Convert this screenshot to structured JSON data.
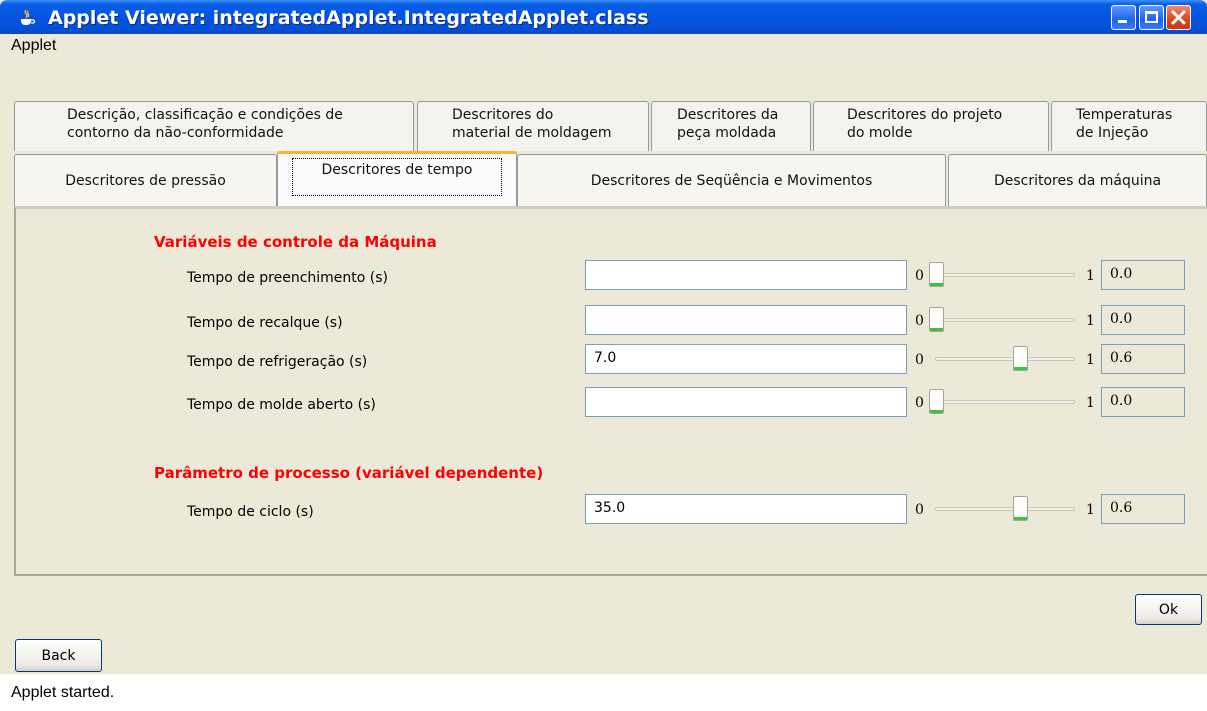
{
  "window": {
    "title": "Applet Viewer: integratedApplet.IntegratedApplet.class",
    "controls": [
      "minimize",
      "maximize",
      "close"
    ]
  },
  "menu": {
    "items": [
      "Applet"
    ]
  },
  "tabs": {
    "row1": [
      {
        "line1": "Descrição, classificação e condições de",
        "line2": "contorno da não-conformidade"
      },
      {
        "line1": "Descritores do",
        "line2": "material de moldagem"
      },
      {
        "line1": "Descritores da",
        "line2": "peça moldada"
      },
      {
        "line1": "Descritores do projeto",
        "line2": "do molde"
      },
      {
        "line1": "Temperaturas",
        "line2": "de Injeção"
      }
    ],
    "row2": [
      {
        "label": "Descritores de pressão"
      },
      {
        "label": "Descritores de tempo",
        "active": true
      },
      {
        "label": "Descritores de Seqüência e Movimentos"
      },
      {
        "label": "Descritores da máquina"
      }
    ]
  },
  "panel": {
    "section1_title": "Variáveis de controle da Máquina",
    "section2_title": "Parâmetro de processo (variável dependente)",
    "rows": [
      {
        "label": "Tempo de preenchimento (s)",
        "value": "",
        "min": "0",
        "max": "1",
        "level": 0.0,
        "display": "0.0"
      },
      {
        "label": "Tempo de recalque (s)",
        "value": "",
        "min": "0",
        "max": "1",
        "level": 0.0,
        "display": "0.0"
      },
      {
        "label": "Tempo de refrigeração (s)",
        "value": "7.0",
        "min": "0",
        "max": "1",
        "level": 0.6,
        "display": "0.6"
      },
      {
        "label": "Tempo de molde aberto (s)",
        "value": "",
        "min": "0",
        "max": "1",
        "level": 0.0,
        "display": "0.0"
      },
      {
        "label": "Tempo de ciclo (s)",
        "value": "35.0",
        "min": "0",
        "max": "1",
        "level": 0.6,
        "display": "0.6"
      }
    ]
  },
  "buttons": {
    "ok": "Ok",
    "back": "Back"
  },
  "status": "Applet started."
}
